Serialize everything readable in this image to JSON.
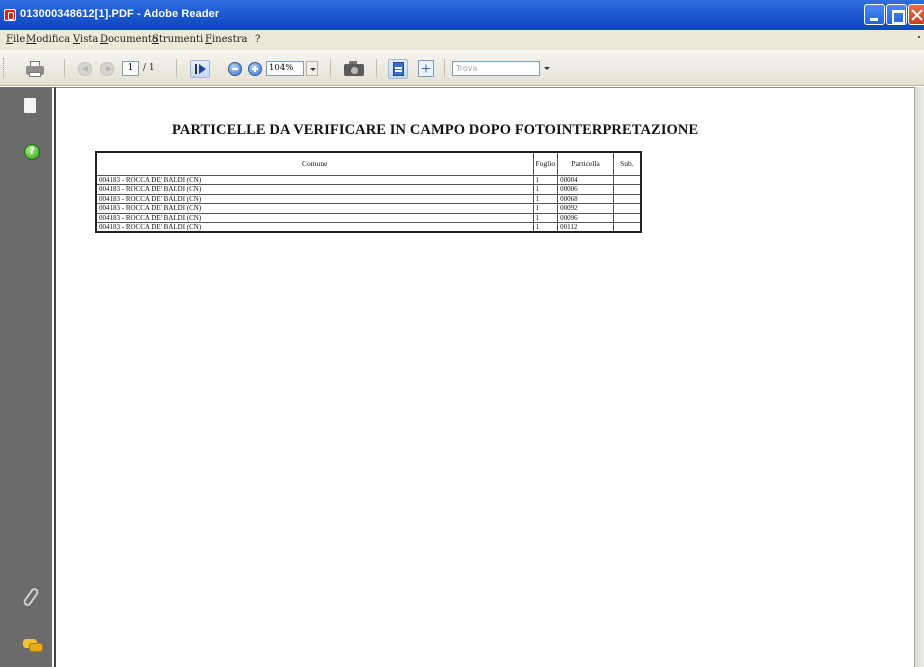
{
  "window": {
    "title": "013000348612[1].PDF - Adobe Reader"
  },
  "menu": {
    "items": [
      "File",
      "Modifica",
      "Vista",
      "Documento",
      "Strumenti",
      "Finestra",
      "?"
    ]
  },
  "toolbar": {
    "page_number": "1",
    "page_total": "/ 1",
    "zoom": "104%",
    "search_placeholder": "Trova"
  },
  "navpanel": {
    "help_glyph": "?"
  },
  "document": {
    "title": "PARTICELLE DA VERIFICARE IN CAMPO DOPO FOTOINTERPRETAZIONE",
    "table": {
      "headers": [
        "Comune",
        "Foglio",
        "Particella",
        "Sub."
      ],
      "rows": [
        [
          "004183 - ROCCA DE' BALDI (CN)",
          "1",
          "00004",
          ""
        ],
        [
          "004183 - ROCCA DE' BALDI (CN)",
          "1",
          "00006",
          ""
        ],
        [
          "004183 - ROCCA DE' BALDI (CN)",
          "1",
          "00068",
          ""
        ],
        [
          "004183 - ROCCA DE' BALDI (CN)",
          "1",
          "00092",
          ""
        ],
        [
          "004183 - ROCCA DE' BALDI (CN)",
          "1",
          "00096",
          ""
        ],
        [
          "004183 - ROCCA DE' BALDI (CN)",
          "1",
          "00112",
          ""
        ]
      ]
    }
  },
  "colors": {
    "titlebar": "#1e5bd4",
    "menubar": "#ece9d8",
    "navpanel": "#6b6b6b"
  }
}
